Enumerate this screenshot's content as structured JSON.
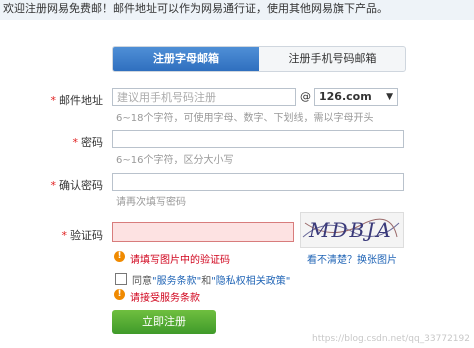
{
  "banner": {
    "text": "欢迎注册网易免费邮！邮件地址可以作为网易通行证，使用其他网易旗下产品。"
  },
  "tabs": [
    {
      "label": "注册字母邮箱"
    },
    {
      "label": "注册手机号码邮箱"
    }
  ],
  "form": {
    "email": {
      "required_mark": "*",
      "label": "邮件地址",
      "placeholder": "建议用手机号码注册",
      "at": "@",
      "domain": "126.com",
      "hint": "6~18个字符，可使用字母、数字、下划线，需以字母开头"
    },
    "password": {
      "required_mark": "*",
      "label": "密码",
      "hint": "6~16个字符，区分大小写"
    },
    "confirm_password": {
      "required_mark": "*",
      "label": "确认密码",
      "hint": "请再次填写密码"
    },
    "captcha": {
      "required_mark": "*",
      "label": "验证码",
      "image_text": "MDBJA",
      "error": "请填写图片中的验证码",
      "refresh_link": "看不清楚？换张图片"
    },
    "agreement": {
      "text_prefix": "同意",
      "terms_link": "\"服务条款\"",
      "and": "和",
      "privacy_link": "\"隐私权相关政策\"",
      "error": "请接受服务条款"
    },
    "submit_label": "立即注册"
  },
  "watermark": "https://blog.csdn.net/qq_33772192",
  "icons": {
    "warning": "warning-icon",
    "dropdown": "triangle-down-icon",
    "checkbox": "checkbox-icon"
  },
  "colors": {
    "accent": "#2f6fbf",
    "error": "#d0021b",
    "submit": "#3f9a2a",
    "warning": "#f08a00"
  }
}
